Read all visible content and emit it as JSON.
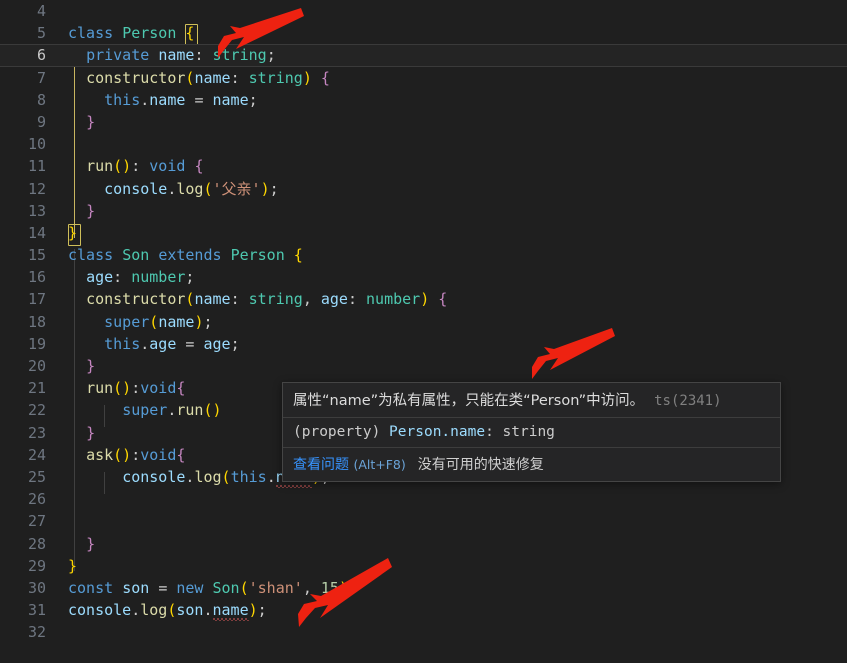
{
  "editor": {
    "gutter_first_line": 4,
    "active_line": 6,
    "lines": [
      {
        "num": 4,
        "text": ""
      },
      {
        "num": 5,
        "text": "class Person {"
      },
      {
        "num": 6,
        "text": "  private name: string;"
      },
      {
        "num": 7,
        "text": "  constructor(name: string) {"
      },
      {
        "num": 8,
        "text": "    this.name = name;"
      },
      {
        "num": 9,
        "text": "  }"
      },
      {
        "num": 10,
        "text": ""
      },
      {
        "num": 11,
        "text": "  run(): void {"
      },
      {
        "num": 12,
        "text": "    console.log('父亲');"
      },
      {
        "num": 13,
        "text": "  }"
      },
      {
        "num": 14,
        "text": "}"
      },
      {
        "num": 15,
        "text": "class Son extends Person {"
      },
      {
        "num": 16,
        "text": "  age: number;"
      },
      {
        "num": 17,
        "text": "  constructor(name: string, age: number) {"
      },
      {
        "num": 18,
        "text": "    super(name);"
      },
      {
        "num": 19,
        "text": "    this.age = age;"
      },
      {
        "num": 20,
        "text": "  }"
      },
      {
        "num": 21,
        "text": "  run():void{"
      },
      {
        "num": 22,
        "text": "      super.run()"
      },
      {
        "num": 23,
        "text": "  }"
      },
      {
        "num": 24,
        "text": "  ask():void{"
      },
      {
        "num": 25,
        "text": "      console.log(this.name);"
      },
      {
        "num": 26,
        "text": ""
      },
      {
        "num": 27,
        "text": ""
      },
      {
        "num": 28,
        "text": "  }"
      },
      {
        "num": 29,
        "text": "}"
      },
      {
        "num": 30,
        "text": "const son = new Son('shan', 15)"
      },
      {
        "num": 31,
        "text": "console.log(son.name);"
      },
      {
        "num": 32,
        "text": ""
      }
    ]
  },
  "tooltip": {
    "message": "属性“name”为私有属性，只能在类“Person”中访问。",
    "error_code": "ts(2341)",
    "signature_kind": "(property)",
    "signature_owner": "Person.name",
    "signature_type": ": string",
    "view_problem_label": "查看问题",
    "view_problem_shortcut": "(Alt+F8)",
    "no_quickfix_label": "没有可用的快速修复"
  },
  "annotations": {
    "arrow_color": "#ee2211",
    "arrows": [
      {
        "name": "arrow-to-private-name",
        "target": "line 6 private name: string;"
      },
      {
        "name": "arrow-to-tooltip",
        "target": "hover tooltip"
      },
      {
        "name": "arrow-to-console-log-son-name",
        "target": "line 31 console.log(son.name);"
      }
    ]
  },
  "colors": {
    "background": "#1f1f1f",
    "active_line_background": "#242424",
    "line_number": "#6e7681",
    "keyword": "#569cd6",
    "type": "#4ec9b0",
    "string": "#ce9178",
    "number": "#b5cea8",
    "property": "#9cdcfe",
    "function": "#dcdcaa",
    "bracket_yellow": "#ffd700",
    "bracket_magenta": "#da70d6",
    "bracket_blue": "#179fff",
    "error_squiggle": "#e05c5c",
    "tooltip_background": "#252526",
    "tooltip_border": "#454545",
    "link": "#3794ff"
  }
}
